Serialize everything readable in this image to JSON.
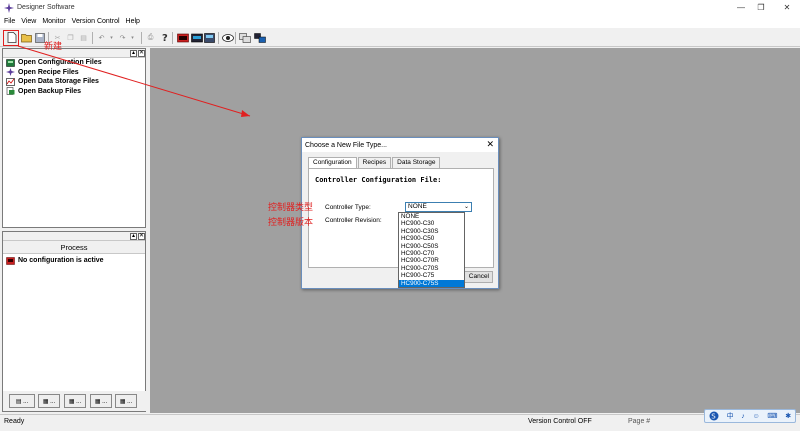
{
  "window": {
    "title": "Designer Software",
    "minimize": "—",
    "maximize": "❐",
    "close": "✕"
  },
  "menu": [
    "File",
    "View",
    "Monitor",
    "Version Control",
    "Help"
  ],
  "annotations": {
    "new_label": "新建",
    "controller_type_label": "控制器类型",
    "controller_revision_label": "控制器版本",
    "accent_color": "#e02020"
  },
  "file_panel": {
    "items": [
      "Open Configuration Files",
      "Open Recipe Files",
      "Open Data Storage Files",
      "Open Backup Files"
    ]
  },
  "process_panel": {
    "title": "Process",
    "status": "No configuration is active"
  },
  "dialog": {
    "title": "Choose a New File Type...",
    "close": "✕",
    "tabs": [
      "Configuration",
      "Recipes",
      "Data Storage"
    ],
    "heading": "Controller Configuration File:",
    "controller_type_label": "Controller Type:",
    "controller_revision_label": "Controller Revision:",
    "selected_value": "NONE",
    "options": [
      "NONE",
      "HC900-C30",
      "HC900-C30S",
      "HC900-C50",
      "HC900-C50S",
      "HC900-C70",
      "HC900-C70R",
      "HC900-C70S",
      "HC900-C75",
      "HC900-C75S"
    ],
    "highlighted_option": "HC900-C75S",
    "cancel_label": "Cancel"
  },
  "statusbar": {
    "ready": "Ready",
    "version_control": "Version Control OFF",
    "page": "Page #"
  },
  "ime": [
    "中",
    "♪",
    "☺",
    "⌨",
    "✱"
  ]
}
